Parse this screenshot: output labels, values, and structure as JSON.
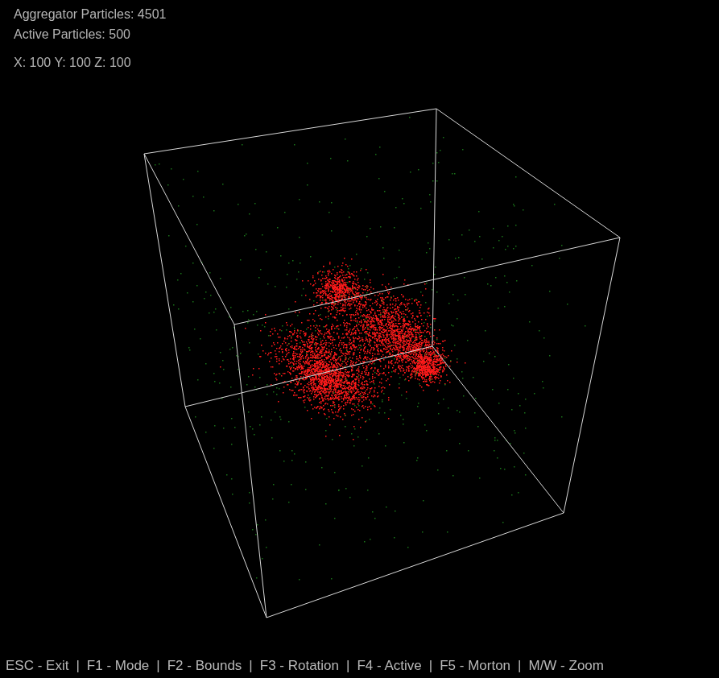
{
  "hud": {
    "stats": [
      "Aggregator Particles: 4501",
      "Active Particles: 500"
    ],
    "dimensions": "X: 100 Y: 100 Z: 100"
  },
  "particle_groups": [
    {
      "kind": "aggregate",
      "color": "#ff1a1a"
    },
    {
      "kind": "active",
      "color": "#1f8f1f"
    }
  ],
  "footer": {
    "separator": "|",
    "items": [
      "ESC - Exit",
      "F1 - Mode",
      "F2 - Bounds",
      "F3 - Rotation",
      "F4 - Active",
      "F5 - Morton",
      "M/W - Zoom"
    ]
  }
}
